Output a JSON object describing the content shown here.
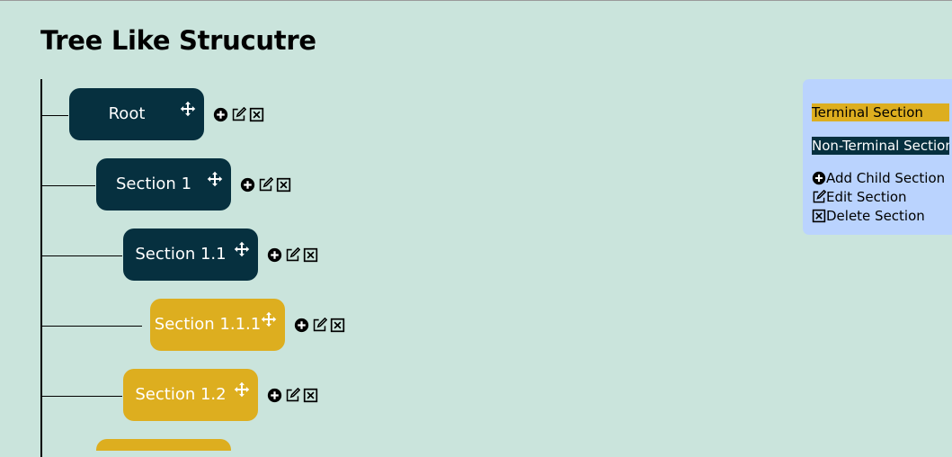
{
  "page": {
    "title": "Tree Like Strucutre"
  },
  "tree": {
    "nodes": [
      {
        "label": "Root",
        "type": "non-terminal"
      },
      {
        "label": "Section 1",
        "type": "non-terminal"
      },
      {
        "label": "Section 1.1",
        "type": "non-terminal"
      },
      {
        "label": "Section 1.1.1",
        "type": "terminal"
      },
      {
        "label": "Section 1.2",
        "type": "terminal"
      },
      {
        "label": "",
        "type": "terminal"
      }
    ]
  },
  "icons": {
    "move": "move-icon",
    "add": "add-circle-icon",
    "edit": "edit-icon",
    "delete": "delete-box-icon"
  },
  "legend": {
    "terminal": "Terminal Section",
    "non_terminal": "Non-Terminal Section",
    "add": "Add Child Section",
    "edit": "Edit Section",
    "delete": "Delete Section"
  },
  "colors": {
    "background": "#cae4dc",
    "non_terminal": "#06303f",
    "terminal": "#ddae1f",
    "legend_bg": "#bad3fe"
  }
}
